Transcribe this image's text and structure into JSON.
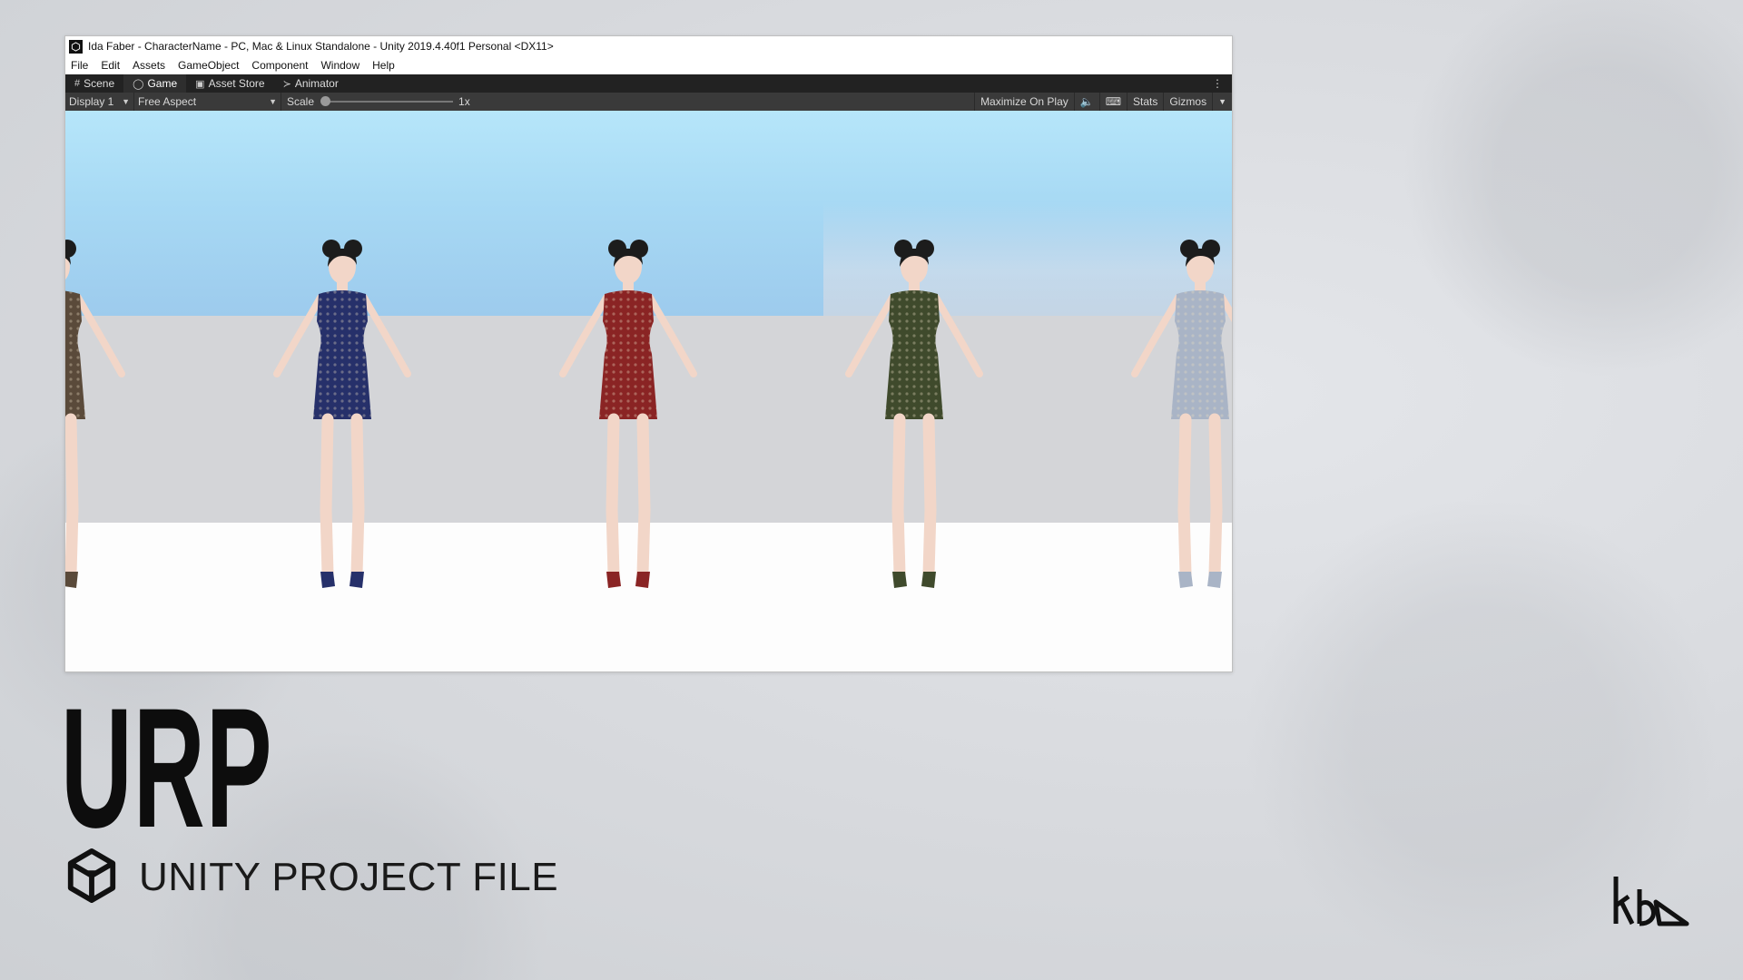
{
  "window": {
    "title": "Ida Faber - CharacterName - PC, Mac & Linux Standalone - Unity 2019.4.40f1 Personal <DX11>"
  },
  "menu": [
    "File",
    "Edit",
    "Assets",
    "GameObject",
    "Component",
    "Window",
    "Help"
  ],
  "tabs": [
    {
      "label": "Scene",
      "icon": "grid-icon"
    },
    {
      "label": "Game",
      "icon": "gamepad-icon"
    },
    {
      "label": "Asset Store",
      "icon": "bag-icon"
    },
    {
      "label": "Animator",
      "icon": "animator-icon"
    }
  ],
  "toolbar": {
    "display": "Display 1",
    "aspect": "Free Aspect",
    "scale_label": "Scale",
    "scale_value": "1x",
    "maximize": "Maximize On Play",
    "stats": "Stats",
    "gizmos": "Gizmos"
  },
  "characters": [
    {
      "dress": "#5a4a3a"
    },
    {
      "dress": "#26306a"
    },
    {
      "dress": "#8a2424"
    },
    {
      "dress": "#3f4a2c"
    },
    {
      "dress": "#a9b4c6"
    }
  ],
  "caption": {
    "title": "URP",
    "subtitle": "UNITY PROJECT FILE"
  }
}
